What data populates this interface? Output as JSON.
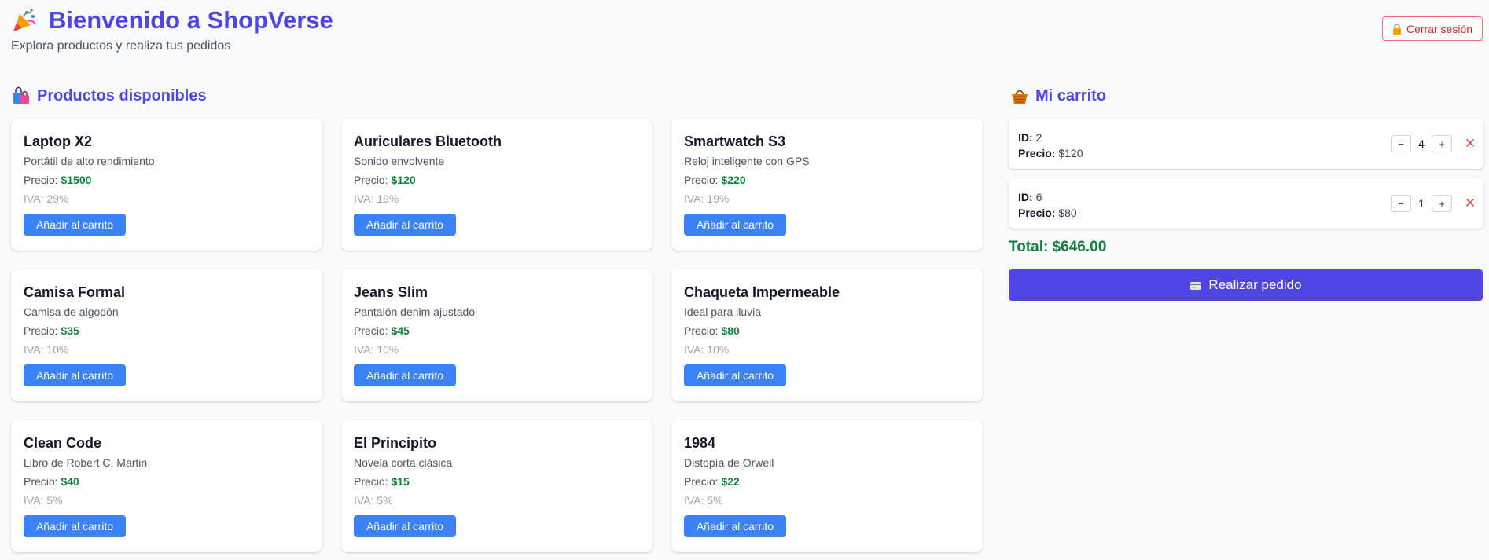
{
  "header": {
    "title": "Bienvenido a ShopVerse",
    "subtitle": "Explora productos y realiza tus pedidos",
    "icon": "party-popper-icon",
    "logout_label": "Cerrar sesión"
  },
  "products_section": {
    "title": "Productos disponibles",
    "icon": "shopping-bags-icon"
  },
  "products": [
    {
      "name": "Laptop X2",
      "description": "Portátil de alto rendimiento",
      "price_label": "Precio:",
      "price": "$1500",
      "iva": "IVA: 29%",
      "button": "Añadir al carrito"
    },
    {
      "name": "Auriculares Bluetooth",
      "description": "Sonido envolvente",
      "price_label": "Precio:",
      "price": "$120",
      "iva": "IVA: 19%",
      "button": "Añadir al carrito"
    },
    {
      "name": "Smartwatch S3",
      "description": "Reloj inteligente con GPS",
      "price_label": "Precio:",
      "price": "$220",
      "iva": "IVA: 19%",
      "button": "Añadir al carrito"
    },
    {
      "name": "Camisa Formal",
      "description": "Camisa de algodón",
      "price_label": "Precio:",
      "price": "$35",
      "iva": "IVA: 10%",
      "button": "Añadir al carrito"
    },
    {
      "name": "Jeans Slim",
      "description": "Pantalón denim ajustado",
      "price_label": "Precio:",
      "price": "$45",
      "iva": "IVA: 10%",
      "button": "Añadir al carrito"
    },
    {
      "name": "Chaqueta Impermeable",
      "description": "Ideal para lluvia",
      "price_label": "Precio:",
      "price": "$80",
      "iva": "IVA: 10%",
      "button": "Añadir al carrito"
    },
    {
      "name": "Clean Code",
      "description": "Libro de Robert C. Martin",
      "price_label": "Precio:",
      "price": "$40",
      "iva": "IVA: 5%",
      "button": "Añadir al carrito"
    },
    {
      "name": "El Principito",
      "description": "Novela corta clásica",
      "price_label": "Precio:",
      "price": "$15",
      "iva": "IVA: 5%",
      "button": "Añadir al carrito"
    },
    {
      "name": "1984",
      "description": "Distopía de Orwell",
      "price_label": "Precio:",
      "price": "$22",
      "iva": "IVA: 5%",
      "button": "Añadir al carrito"
    }
  ],
  "cart": {
    "title": "Mi carrito",
    "icon": "basket-icon",
    "items": [
      {
        "id_label": "ID:",
        "id": "2",
        "price_label": "Precio:",
        "price": "$120",
        "qty": "4",
        "minus": "−",
        "plus": "+",
        "remove": "✕"
      },
      {
        "id_label": "ID:",
        "id": "6",
        "price_label": "Precio:",
        "price": "$80",
        "qty": "1",
        "minus": "−",
        "plus": "+",
        "remove": "✕"
      }
    ],
    "total": "Total: $646.00",
    "order_button": "Realizar pedido"
  },
  "colors": {
    "brand": "#4f46e5",
    "accent_button": "#3b82f6",
    "price": "#15803d",
    "danger": "#dc2626",
    "background": "#f9fafb"
  }
}
